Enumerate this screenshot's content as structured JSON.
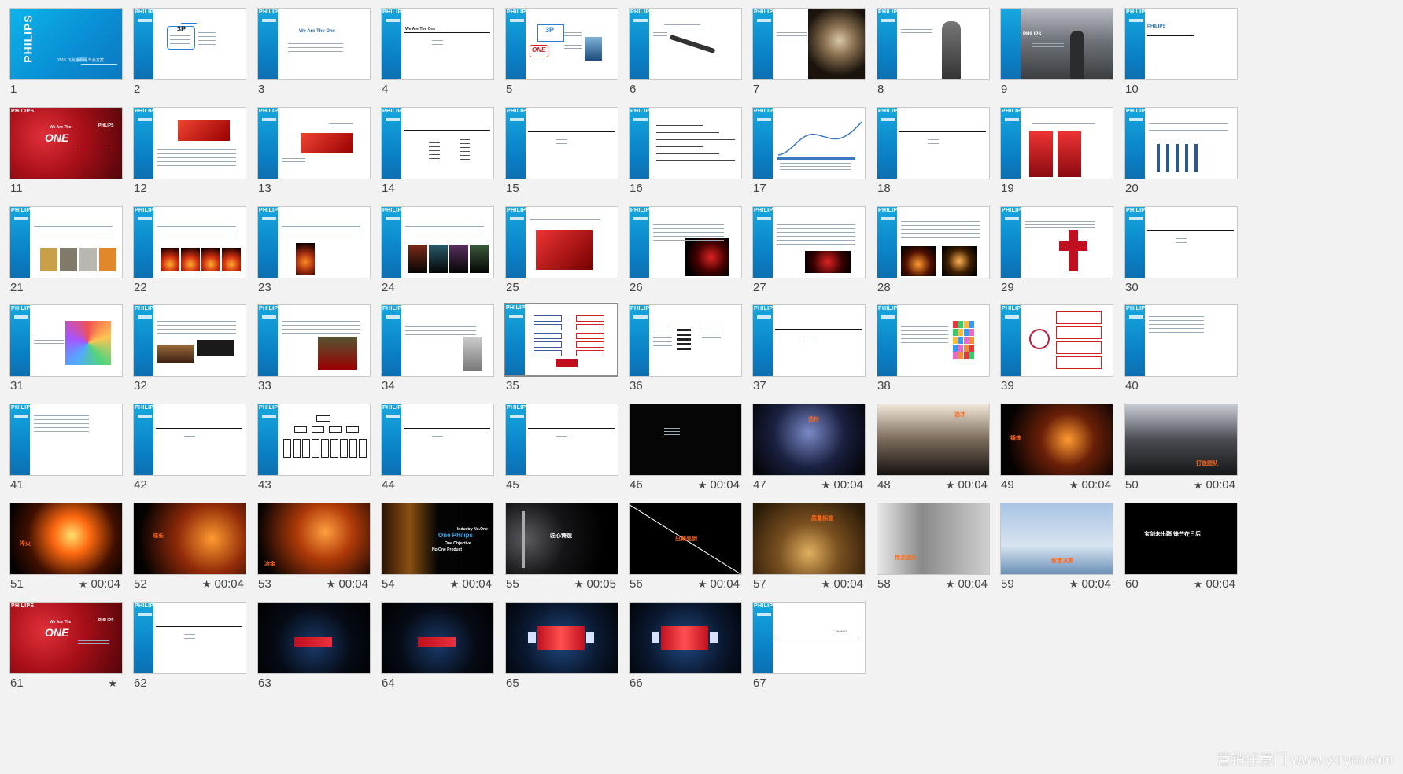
{
  "brand": "PHILIPS",
  "watermark": "营销任意门 www.yxrym.com",
  "timing_star": "★",
  "colors": {
    "accent_blue": "#0a8fd6",
    "slide_dark": "#050505",
    "panel_bg": "#f2f2f2",
    "highlight_orange": "#ff6a1a",
    "cover_red": "#c0111a"
  },
  "slides": [
    {
      "n": "1",
      "timing": "",
      "kind": "cover-blue",
      "texts": [
        "PHILIPS",
        "2016 飞利浦照明 年会方案"
      ]
    },
    {
      "n": "2",
      "timing": "",
      "kind": "diagram-3p",
      "texts": [
        "3P"
      ]
    },
    {
      "n": "3",
      "timing": "",
      "kind": "title-text",
      "texts": [
        "We Are The One"
      ]
    },
    {
      "n": "4",
      "timing": "",
      "kind": "section-rule",
      "texts": [
        "We Are The One"
      ]
    },
    {
      "n": "5",
      "timing": "",
      "kind": "diagram-3p-one",
      "texts": [
        "3P",
        "ONE"
      ]
    },
    {
      "n": "6",
      "timing": "",
      "kind": "question-tool",
      "texts": []
    },
    {
      "n": "7",
      "timing": "",
      "kind": "photo-sand",
      "texts": [
        "PHILIPS"
      ]
    },
    {
      "n": "8",
      "timing": "",
      "kind": "photo-fist",
      "texts": [
        "PHILIPS"
      ]
    },
    {
      "n": "9",
      "timing": "",
      "kind": "photo-man",
      "texts": [
        "PHILIPS"
      ]
    },
    {
      "n": "10",
      "timing": "",
      "kind": "blank-title",
      "texts": [
        "PHILIPS"
      ]
    },
    {
      "n": "11",
      "timing": "",
      "kind": "cover-red",
      "texts": [
        "We Are The",
        "ONE",
        "PHILIPS"
      ]
    },
    {
      "n": "12",
      "timing": "",
      "kind": "text-redimg",
      "texts": []
    },
    {
      "n": "13",
      "timing": "",
      "kind": "redimg-callouts",
      "texts": []
    },
    {
      "n": "14",
      "timing": "",
      "kind": "tree-lines",
      "texts": []
    },
    {
      "n": "15",
      "timing": "",
      "kind": "section-rule",
      "texts": []
    },
    {
      "n": "16",
      "timing": "",
      "kind": "bracket-list",
      "texts": []
    },
    {
      "n": "17",
      "timing": "",
      "kind": "curve-chart",
      "texts": []
    },
    {
      "n": "18",
      "timing": "",
      "kind": "section-rule",
      "texts": []
    },
    {
      "n": "19",
      "timing": "",
      "kind": "two-red-panels",
      "texts": []
    },
    {
      "n": "20",
      "timing": "",
      "kind": "bottles",
      "texts": []
    },
    {
      "n": "21",
      "timing": "",
      "kind": "strip-gold",
      "texts": []
    },
    {
      "n": "22",
      "timing": "",
      "kind": "strip-fire",
      "texts": []
    },
    {
      "n": "23",
      "timing": "",
      "kind": "strip-lava",
      "texts": []
    },
    {
      "n": "24",
      "timing": "",
      "kind": "strip-dark",
      "texts": []
    },
    {
      "n": "25",
      "timing": "",
      "kind": "red-card",
      "texts": []
    },
    {
      "n": "26",
      "timing": "",
      "kind": "text-cube",
      "texts": []
    },
    {
      "n": "27",
      "timing": "",
      "kind": "text-stage",
      "texts": []
    },
    {
      "n": "28",
      "timing": "",
      "kind": "two-lanterns",
      "texts": []
    },
    {
      "n": "29",
      "timing": "",
      "kind": "red-cross",
      "texts": []
    },
    {
      "n": "30",
      "timing": "",
      "kind": "section-rule",
      "texts": []
    },
    {
      "n": "31",
      "timing": "",
      "kind": "led-wall",
      "texts": []
    },
    {
      "n": "32",
      "timing": "",
      "kind": "theatre-knife",
      "texts": []
    },
    {
      "n": "33",
      "timing": "",
      "kind": "text-redseats",
      "texts": []
    },
    {
      "n": "34",
      "timing": "",
      "kind": "text-corner",
      "texts": []
    },
    {
      "n": "35",
      "timing": "",
      "kind": "flow-two-col",
      "texts": [],
      "selected": true
    },
    {
      "n": "36",
      "timing": "",
      "kind": "schedule",
      "texts": []
    },
    {
      "n": "37",
      "timing": "",
      "kind": "section-rule",
      "texts": []
    },
    {
      "n": "38",
      "timing": "",
      "kind": "color-tiles",
      "texts": []
    },
    {
      "n": "39",
      "timing": "",
      "kind": "logo-boxes",
      "texts": []
    },
    {
      "n": "40",
      "timing": "",
      "kind": "text-only",
      "texts": []
    },
    {
      "n": "41",
      "timing": "",
      "kind": "text-only",
      "texts": []
    },
    {
      "n": "42",
      "timing": "",
      "kind": "section-rule",
      "texts": []
    },
    {
      "n": "43",
      "timing": "",
      "kind": "org-chart",
      "texts": []
    },
    {
      "n": "44",
      "timing": "",
      "kind": "section-rule",
      "texts": []
    },
    {
      "n": "45",
      "timing": "",
      "kind": "section-rule",
      "texts": []
    },
    {
      "n": "46",
      "timing": "00:04",
      "kind": "black-text",
      "texts": []
    },
    {
      "n": "47",
      "timing": "00:04",
      "kind": "miner",
      "texts": [
        "选材"
      ]
    },
    {
      "n": "48",
      "timing": "00:04",
      "kind": "chess",
      "texts": [
        "选才"
      ]
    },
    {
      "n": "49",
      "timing": "00:04",
      "kind": "forge",
      "texts": [
        "锤炼"
      ]
    },
    {
      "n": "50",
      "timing": "00:04",
      "kind": "team",
      "texts": [
        "打造",
        "团队"
      ]
    },
    {
      "n": "51",
      "timing": "00:04",
      "kind": "hot-iron",
      "texts": [
        "淬火"
      ]
    },
    {
      "n": "52",
      "timing": "00:04",
      "kind": "fire-figure",
      "texts": [
        "成长"
      ]
    },
    {
      "n": "53",
      "timing": "00:04",
      "kind": "molten",
      "texts": [
        "冶金"
      ]
    },
    {
      "n": "54",
      "timing": "00:04",
      "kind": "dollar-fire",
      "texts": [
        "Industry No.One",
        "One Philips",
        "One Objective",
        "No.One Product"
      ]
    },
    {
      "n": "55",
      "timing": "00:05",
      "kind": "sword",
      "texts": [
        "匠心铸造"
      ]
    },
    {
      "n": "56",
      "timing": "00:04",
      "kind": "diagonal",
      "texts": [
        "出鞘亮剑"
      ]
    },
    {
      "n": "57",
      "timing": "00:04",
      "kind": "weights",
      "texts": [
        "质量标准"
      ]
    },
    {
      "n": "58",
      "timing": "00:04",
      "kind": "business",
      "texts": [
        "精英团队"
      ]
    },
    {
      "n": "59",
      "timing": "00:04",
      "kind": "hand",
      "texts": [
        "智慧决策"
      ]
    },
    {
      "n": "60",
      "timing": "00:04",
      "kind": "black-slogan",
      "texts": [
        "宝剑未出鞘",
        "锋芒在日后"
      ]
    },
    {
      "n": "61",
      "timing": "",
      "kind": "cover-red",
      "texts": [
        "We Are The",
        "ONE",
        "PHILIPS"
      ]
    },
    {
      "n": "62",
      "timing": "",
      "kind": "section-rule",
      "texts": []
    },
    {
      "n": "63",
      "timing": "",
      "kind": "stage",
      "texts": []
    },
    {
      "n": "64",
      "timing": "",
      "kind": "stage",
      "texts": []
    },
    {
      "n": "65",
      "timing": "",
      "kind": "stage-bright",
      "texts": []
    },
    {
      "n": "66",
      "timing": "",
      "kind": "stage-bright",
      "texts": []
    },
    {
      "n": "67",
      "timing": "",
      "kind": "thanks",
      "texts": [
        "THANKS"
      ]
    }
  ]
}
